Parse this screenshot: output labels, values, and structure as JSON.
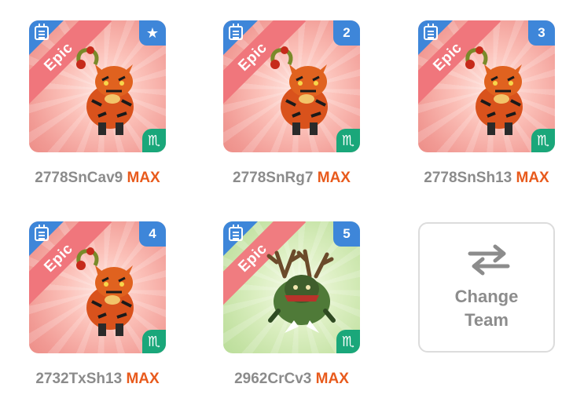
{
  "team": [
    {
      "rarity": "Epic",
      "slot_badge": "star",
      "slot_label": "",
      "name": "2778SnCav9",
      "level_tag": "MAX",
      "zodiac": "♏",
      "theme": "red",
      "creature": "fire-tiger"
    },
    {
      "rarity": "Epic",
      "slot_badge": "number",
      "slot_label": "2",
      "name": "2778SnRg7",
      "level_tag": "MAX",
      "zodiac": "♏",
      "theme": "red",
      "creature": "fire-tiger"
    },
    {
      "rarity": "Epic",
      "slot_badge": "number",
      "slot_label": "3",
      "name": "2778SnSh13",
      "level_tag": "MAX",
      "zodiac": "♏",
      "theme": "red",
      "creature": "fire-tiger"
    },
    {
      "rarity": "Epic",
      "slot_badge": "number",
      "slot_label": "4",
      "name": "2732TxSh13",
      "level_tag": "MAX",
      "zodiac": "♏",
      "theme": "red",
      "creature": "fire-tiger"
    },
    {
      "rarity": "Epic",
      "slot_badge": "number",
      "slot_label": "5",
      "name": "2962CrCv3",
      "level_tag": "MAX",
      "zodiac": "♏",
      "theme": "green",
      "creature": "antlered-beast"
    }
  ],
  "change_team": {
    "line1": "Change",
    "line2": "Team",
    "icon": "swap-arrows-icon"
  },
  "colors": {
    "epic_ribbon": "#f0767c",
    "slot_blue": "#3e86d9",
    "zodiac_green": "#1aa77a",
    "max_orange": "#e85a1c",
    "name_gray": "#8b8b8b"
  }
}
